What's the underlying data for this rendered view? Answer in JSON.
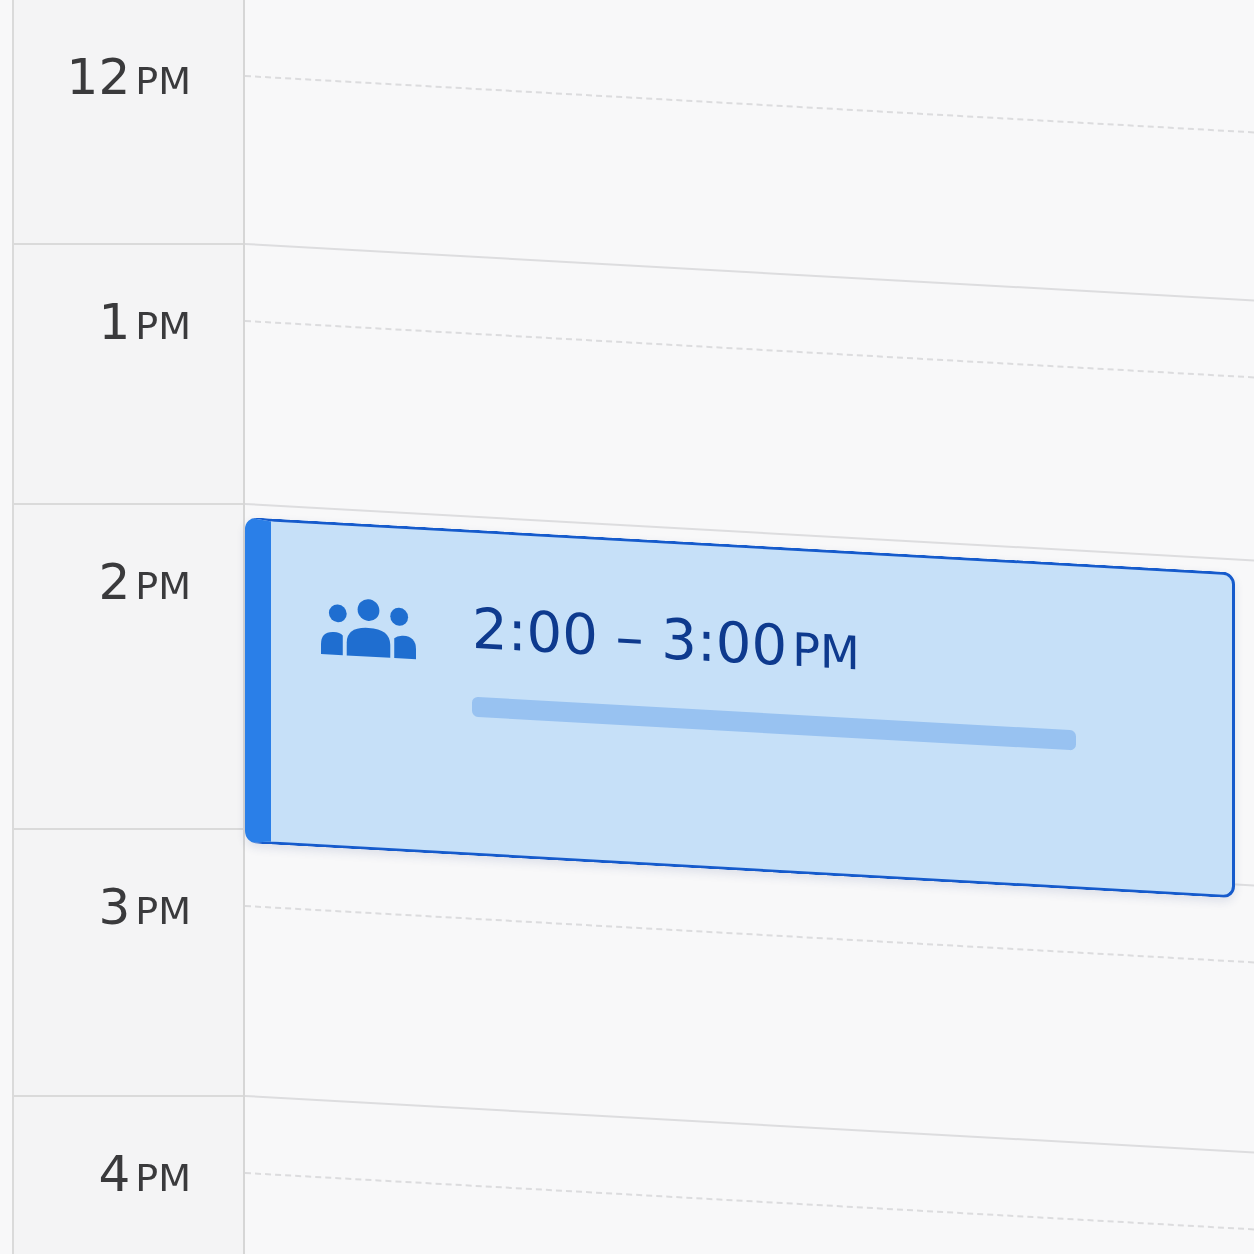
{
  "hours": [
    {
      "hour": "12",
      "period": "PM"
    },
    {
      "hour": "1",
      "period": "PM"
    },
    {
      "hour": "2",
      "period": "PM",
      "events": [
        {
          "time": "2:00 – 3:00",
          "period": "PM"
        }
      ]
    },
    {
      "hour": "3",
      "period": "PM"
    },
    {
      "hour": "4",
      "period": "PM"
    }
  ]
}
